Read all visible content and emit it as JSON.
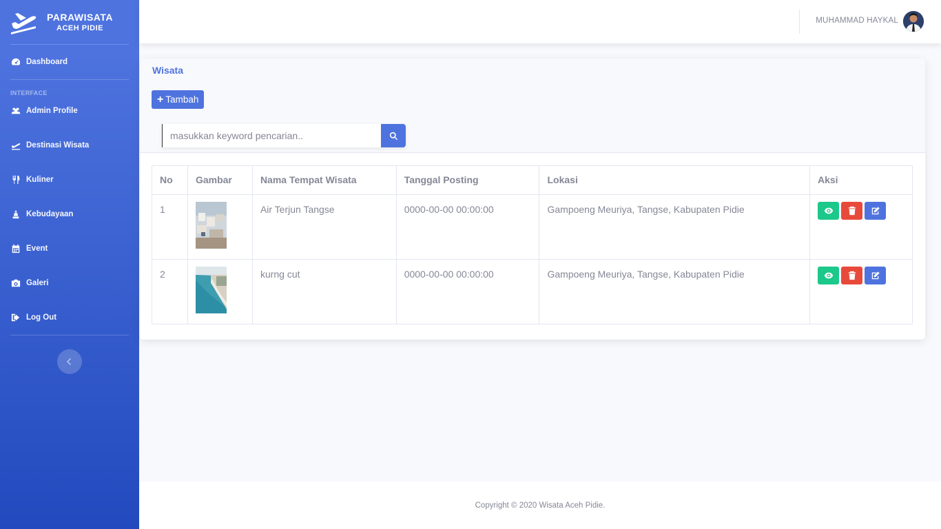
{
  "brand": {
    "title": "PARAWISATA",
    "subtitle": "ACEH PIDIE",
    "icon": "plane-departure-icon"
  },
  "sidebar": {
    "items_top": [
      {
        "label": "Dashboard",
        "icon": "tachometer-icon"
      }
    ],
    "heading": "INTERFACE",
    "items": [
      {
        "label": "Admin Profile",
        "icon": "users-icon"
      },
      {
        "label": "Destinasi Wisata",
        "icon": "plane-icon"
      },
      {
        "label": "Kuliner",
        "icon": "utensils-icon"
      },
      {
        "label": "Kebudayaan",
        "icon": "landmark-icon"
      },
      {
        "label": "Event",
        "icon": "calendar-icon"
      },
      {
        "label": "Galeri",
        "icon": "camera-icon"
      },
      {
        "label": "Log Out",
        "icon": "sign-out-icon"
      }
    ],
    "toggle_icon": "chevron-left-icon"
  },
  "topbar": {
    "user_name": "MUHAMMAD HAYKAL"
  },
  "card": {
    "title": "Wisata",
    "add_label": "Tambah",
    "search_placeholder": "masukkan keyword pencarian.."
  },
  "table": {
    "headers": [
      "No",
      "Gambar",
      "Nama Tempat Wisata",
      "Tanggal Posting",
      "Lokasi",
      "Aksi"
    ],
    "rows": [
      {
        "no": "1",
        "nama": "Air Terjun Tangse",
        "tanggal": "0000-00-00 00:00:00",
        "lokasi": "Gampoeng Meuriya, Tangse, Kabupaten Pidie"
      },
      {
        "no": "2",
        "nama": "kurng cut",
        "tanggal": "0000-00-00 00:00:00",
        "lokasi": "Gampoeng Meuriya, Tangse, Kabupaten Pidie"
      }
    ]
  },
  "footer": {
    "copyright": "Copyright © 2020 Wisata Aceh Pidie."
  },
  "colors": {
    "primary": "#4e73df",
    "success": "#1cc88a",
    "danger": "#e74a3b"
  }
}
